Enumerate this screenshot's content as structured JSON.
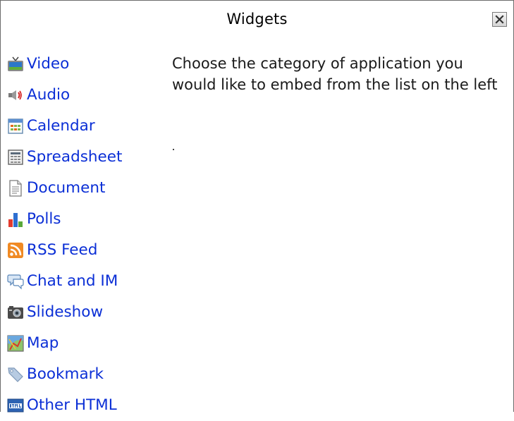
{
  "dialog": {
    "title": "Widgets",
    "close_icon": "close-x-icon"
  },
  "menu": {
    "items": [
      {
        "label": "Video",
        "icon": "tv-icon"
      },
      {
        "label": "Audio",
        "icon": "speaker-icon"
      },
      {
        "label": "Calendar",
        "icon": "calendar-icon"
      },
      {
        "label": "Spreadsheet",
        "icon": "spreadsheet-icon"
      },
      {
        "label": "Document",
        "icon": "document-icon"
      },
      {
        "label": "Polls",
        "icon": "bar-chart-icon"
      },
      {
        "label": "RSS Feed",
        "icon": "rss-icon"
      },
      {
        "label": "Chat and IM",
        "icon": "chat-bubble-icon"
      },
      {
        "label": "Slideshow",
        "icon": "camera-icon"
      },
      {
        "label": "Map",
        "icon": "map-icon"
      },
      {
        "label": "Bookmark",
        "icon": "tag-icon"
      },
      {
        "label": "Other HTML",
        "icon": "html-icon"
      }
    ]
  },
  "info": {
    "text": "Choose the category of application you would like to embed from the list on the left"
  },
  "colors": {
    "link": "#0b2fd6",
    "text": "#1a1a1a",
    "border": "#6b6b6b"
  }
}
